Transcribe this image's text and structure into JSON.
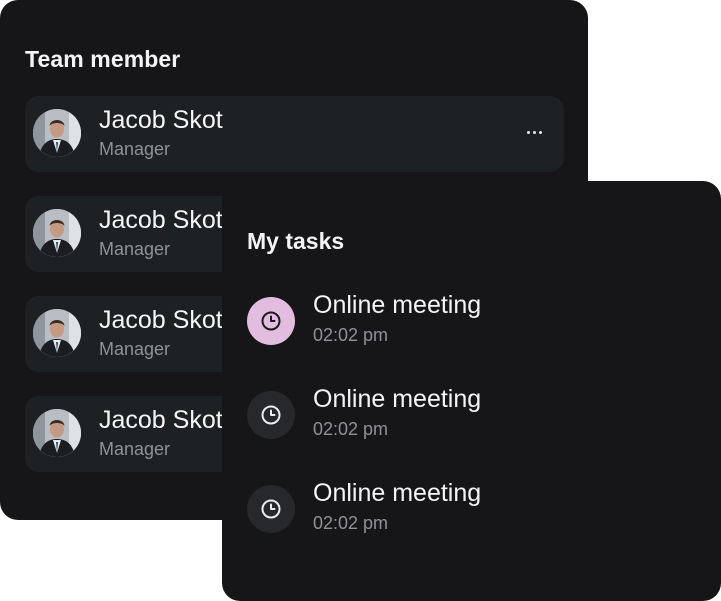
{
  "team": {
    "title": "Team member",
    "members": [
      {
        "name": "Jacob Skot",
        "role": "Manager"
      },
      {
        "name": "Jacob Skot",
        "role": "Manager"
      },
      {
        "name": "Jacob Skot",
        "role": "Manager"
      },
      {
        "name": "Jacob Skot",
        "role": "Manager"
      }
    ],
    "more_icon": "more-horizontal-icon"
  },
  "tasks": {
    "title": "My tasks",
    "items": [
      {
        "title": "Online meeting",
        "time": "02:02 pm",
        "icon": "clock-icon",
        "active": true
      },
      {
        "title": "Online meeting",
        "time": "02:02 pm",
        "icon": "clock-icon",
        "active": false
      },
      {
        "title": "Online meeting",
        "time": "02:02 pm",
        "icon": "clock-icon",
        "active": false
      }
    ]
  },
  "colors": {
    "card_background": "#161618",
    "row_background": "#1e2124",
    "accent_icon_active": "#e3bde0",
    "icon_inactive_background": "#26282c",
    "primary_text": "#f5f5f6",
    "secondary_text": "#8f9196"
  }
}
